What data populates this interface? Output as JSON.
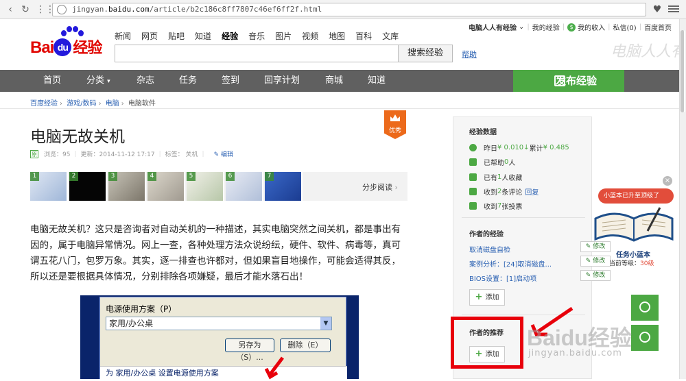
{
  "browser": {
    "url_prefix": "jingyan.",
    "url_domain": "baidu.com",
    "url_path": "/article/b2c186c8ff7807c46ef6ff2f.html"
  },
  "header": {
    "logo_text_a": "Bai",
    "logo_text_du": "du",
    "logo_text_jy": "经验",
    "topnav": [
      "新闻",
      "网页",
      "贴吧",
      "知道",
      "经验",
      "音乐",
      "图片",
      "视频",
      "地图",
      "百科",
      "文库"
    ],
    "search_button": "搜索经验",
    "help_link": "帮助",
    "user": {
      "name": "电脑人人有经验",
      "my_exp": "我的经验",
      "income": "我的收入",
      "message": "私信(0)",
      "home": "百度首页"
    },
    "watermark": "电脑人人有"
  },
  "mainnav": {
    "items": [
      "首页",
      "分类",
      "杂志",
      "任务",
      "签到",
      "回享计划",
      "商城",
      "知道"
    ],
    "publish": "发布经验"
  },
  "breadcrumb": [
    "百度经验",
    "游戏/数码",
    "电脑",
    "电脑软件"
  ],
  "article": {
    "title": "电脑无故关机",
    "badge": "优秀",
    "meta_source": "原",
    "views": "浏览：95",
    "updated": "更新：2014-11-12 17:17",
    "tags": "标签：  关机",
    "edit": "编辑",
    "step_numbers": [
      "1",
      "2",
      "3",
      "4",
      "5",
      "6",
      "7"
    ],
    "step_reading": "分步阅读",
    "body": "电脑无故关机？这只是咨询者对自动关机的一种描述，其实电脑突然之间关机，都是事出有因的，属于电脑异常情况。网上一查，各种处理方法众说纷纭，硬件、软件、病毒等，真可谓五花八门，包罗万象。其实，逐一排查也许都对，但如果盲目地操作，可能会适得其反，所以还是要根据具体情况，分别排除各项嫌疑，最后才能水落石出！"
  },
  "screenshot": {
    "label": "电源使用方案（P）",
    "selected": "家用/办公桌",
    "save_as": "另存为（S）...",
    "delete": "删除（E）",
    "sub": "为 家用/办公桌 设置电源使用方案"
  },
  "sidebar": {
    "exp_data_title": "经验数据",
    "stats": [
      {
        "pre": "昨日 ",
        "val": "¥ 0.010",
        "mid": " 累计 ",
        "val2": "¥ 0.485"
      },
      {
        "pre": "已帮助 ",
        "val": "0",
        "post": " 人"
      },
      {
        "pre": "已有 ",
        "val": "1",
        "post": " 人收藏"
      },
      {
        "pre": "收到 ",
        "val": "2",
        "post": " 条评论",
        "link": "回复"
      },
      {
        "pre": "收到 ",
        "val": "7",
        "post": " 张投票"
      }
    ],
    "author_exp_title": "作者的经验",
    "author_exp_items": [
      "取消磁盘自检",
      "案例分析：[24]取消磁盘...",
      "BIOS设置：[1]启动项"
    ],
    "modify": "修改",
    "add": "添加",
    "author_rec_title": "作者的推荐"
  },
  "taskbook": {
    "bubble": "小蓝本已升至顶级了",
    "name": "任务小蓝本",
    "level_label": "当前等级：",
    "level": "30级"
  },
  "watermark_bottom": "Baidu经验",
  "watermark_url": "jingyan.baidu.com"
}
